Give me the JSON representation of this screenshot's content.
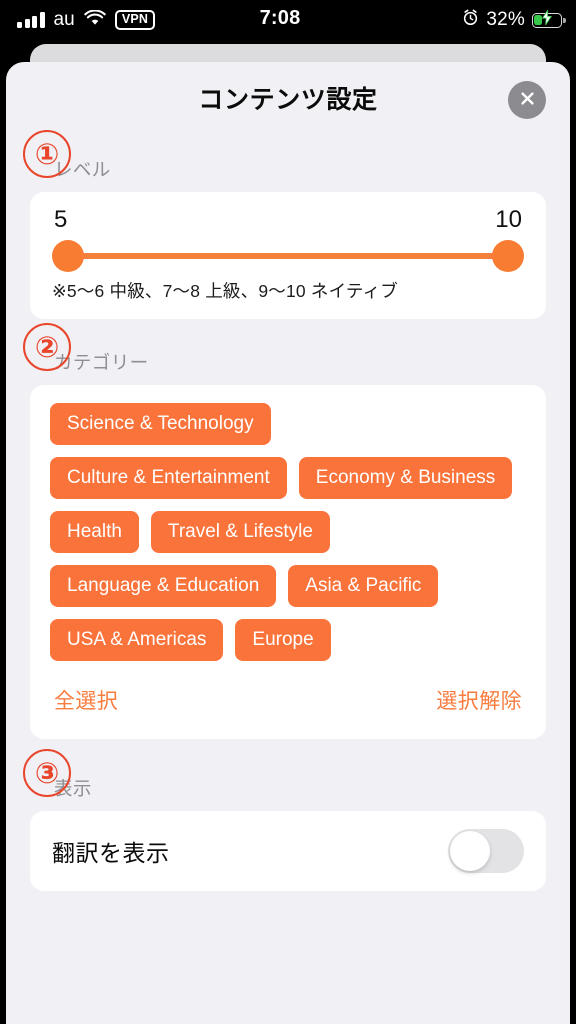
{
  "status_bar": {
    "carrier": "au",
    "vpn_badge": "VPN",
    "time": "7:08",
    "battery_percent": "32%",
    "battery_level": 32,
    "charging": true,
    "alarm_set": true,
    "signal_bars": 4,
    "icons": {
      "signal": "signal-bars-icon",
      "wifi": "wifi-icon",
      "vpn": "vpn-badge-icon",
      "alarm": "alarm-clock-icon",
      "battery": "battery-charging-icon"
    }
  },
  "sheet": {
    "title": "コンテンツ設定",
    "close_icon": "close-x-icon"
  },
  "sections": [
    {
      "number": "①",
      "label": "レベル"
    },
    {
      "number": "②",
      "label": "カテゴリー"
    },
    {
      "number": "③",
      "label": "表示"
    }
  ],
  "level": {
    "min_value": "5",
    "max_value": "10",
    "range_min": 5,
    "range_max": 10,
    "note": "※5〜6 中級、7〜8 上級、9〜10 ネイティブ"
  },
  "categories": {
    "rows": [
      [
        {
          "label": "Science & Technology",
          "selected": true
        }
      ],
      [
        {
          "label": "Culture & Entertainment",
          "selected": true
        },
        {
          "label": "Economy & Business",
          "selected": true
        }
      ],
      [
        {
          "label": "Health",
          "selected": true
        },
        {
          "label": "Travel & Lifestyle",
          "selected": true
        }
      ],
      [
        {
          "label": "Language & Education",
          "selected": true
        },
        {
          "label": "Asia & Pacific",
          "selected": true
        }
      ],
      [
        {
          "label": "USA & Americas",
          "selected": true
        },
        {
          "label": "Europe",
          "selected": true
        }
      ]
    ],
    "select_all_label": "全選択",
    "deselect_all_label": "選択解除"
  },
  "display": {
    "translation_label": "翻訳を表示",
    "translation_enabled": false
  },
  "colors": {
    "accent_orange": "#F9733A",
    "slider_orange": "#F97C33",
    "link_orange": "#F97C3F",
    "annotation_red": "#E8452B",
    "sheet_bg": "#F1F1F5",
    "card_bg": "#FFFFFF",
    "label_gray": "#8E8E93",
    "close_gray": "#8B8B90",
    "switch_off": "#E3E3E6",
    "battery_green": "#37C84A"
  }
}
